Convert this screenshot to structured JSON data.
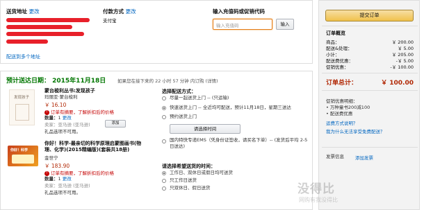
{
  "address": {
    "title": "送货地址",
    "edit": "更改",
    "more": "配送到多个地址"
  },
  "payment": {
    "title": "付款方式",
    "edit": "更改",
    "method": "支付宝"
  },
  "promo": {
    "title": "输入充值码或促销代码",
    "placeholder": "输入充值码",
    "apply": "输入"
  },
  "shipment": {
    "estimate": "预计送达日期： 2015年11月18日",
    "note": "如果您在接下来的 22 小时 57 分钟 内订购 (详情)",
    "items": [
      {
        "title": "蒙台梭利丛书:发现孩子",
        "author": "玛丽亚·蒙台梭利",
        "price": "￥ 16.10",
        "warn": "订单有摘要，了解折扣后的价格",
        "qty_label": "数量：",
        "qty": "1",
        "qty_edit": "更改",
        "seller": "卖家：亚马逊 (亚马逊)",
        "gift": "礼品选项不可用。",
        "thumb": "发现孩子"
      },
      {
        "title": "你好！科学-最亲切的科学原理启蒙图画书(物理、化学)(2015精编版)(套装共18册)",
        "author": "金世宁",
        "price": "￥ 183.90",
        "warn": "订单有摘要，了解折扣后的价格",
        "qty_label": "数量：",
        "qty": "1",
        "qty_edit": "更改",
        "seller": "卖家：亚马逊 (亚马逊)",
        "gift": "礼品选项不可用。",
        "thumb": "你好！科学"
      }
    ],
    "gift_button": "添加",
    "delivery": {
      "title": "选择配送方式：",
      "options": [
        "尽量一起送货上门 -- (只运输)",
        "快速送货上门 -- 全近均可配送，预计11月18日，星期三送达",
        "预约送货上门"
      ],
      "time_button": "请选择时间",
      "ems": "国内特快专递EMS（凭身份证签收，请买名下单）-- (发货后平均 2-5日送达)"
    },
    "time": {
      "title": "请选择希望送货的时间：",
      "options": [
        "工作日、双休日或假日均可送货",
        "只工作日送货",
        "只双休日、假日送货"
      ]
    }
  },
  "summary": {
    "submit": "提交订单",
    "title": "订单概览",
    "rows": [
      {
        "label": "商品：",
        "value": "￥ 200.00"
      },
      {
        "label": "配送&处理：",
        "value": "￥ 5.00"
      },
      {
        "label": "小计：",
        "value": "￥ 205.00"
      },
      {
        "label": "配送费优惠：",
        "value": "-￥ 5.00"
      },
      {
        "label": "促销优惠：",
        "value": "-￥ 100.00"
      }
    ],
    "total_label": "订单总计：",
    "total_value": "￥ 100.00",
    "promo_title": "促销优惠明细：",
    "promo_lines": [
      "• 万种童书200减100",
      "• 配送费优惠"
    ],
    "link_how": "运费方式说明？",
    "link_why": "我为什么无法享受免费配送？",
    "invoice_label": "发票信息",
    "invoice_link": "添加发票"
  },
  "watermark": {
    "main": "没得比",
    "sub": "网购有我没得比"
  },
  "colors": {
    "accent": "#f0c14b",
    "price": "#b12704",
    "link": "#0066c0",
    "green": "#007600"
  }
}
